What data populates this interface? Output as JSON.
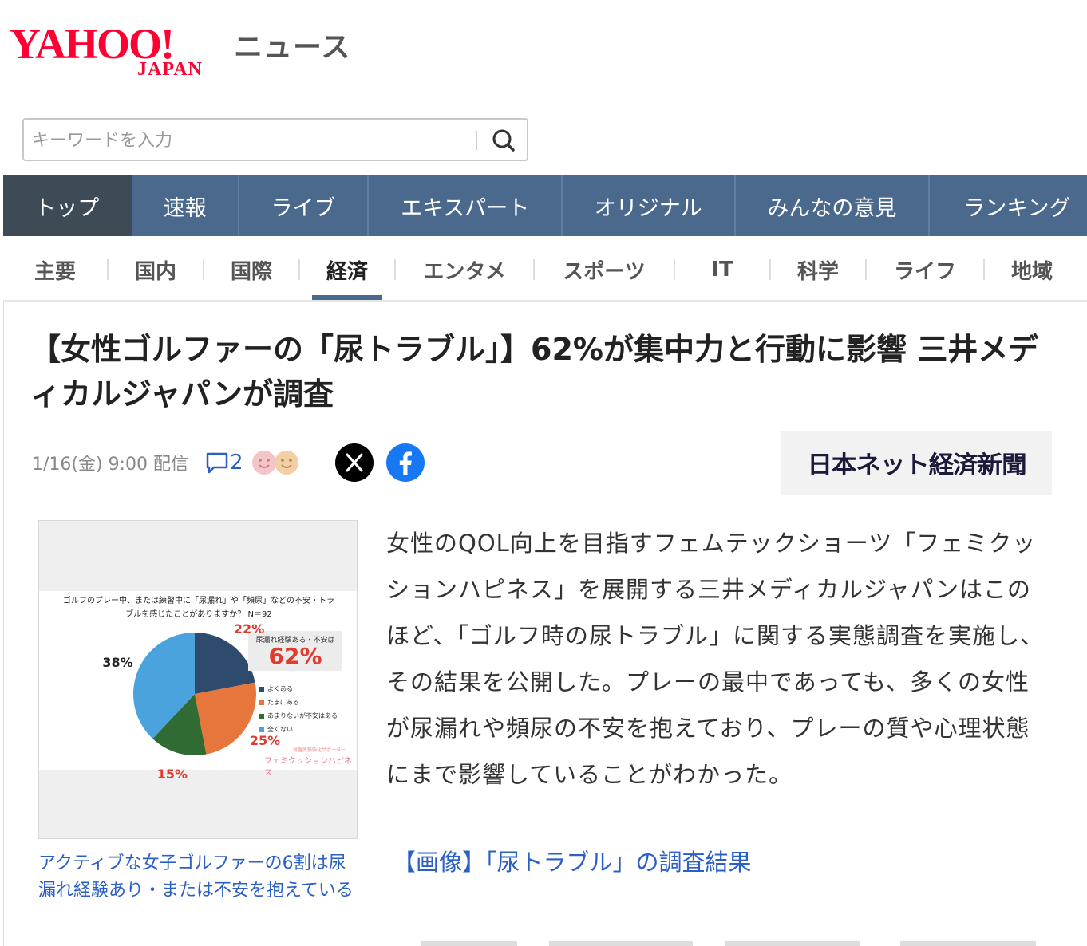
{
  "header": {
    "logo_yahoo": "YAHOO!",
    "logo_japan": "JAPAN",
    "logo_news": "ニュース"
  },
  "search": {
    "placeholder": "キーワードを入力",
    "icon": "search-icon"
  },
  "main_nav": {
    "items": [
      {
        "label": "トップ",
        "active": true
      },
      {
        "label": "速報"
      },
      {
        "label": "ライブ"
      },
      {
        "label": "エキスパート"
      },
      {
        "label": "オリジナル"
      },
      {
        "label": "みんなの意見"
      },
      {
        "label": "ランキング"
      }
    ]
  },
  "sub_nav": {
    "items": [
      {
        "label": "主要"
      },
      {
        "label": "国内"
      },
      {
        "label": "国際"
      },
      {
        "label": "経済",
        "active": true
      },
      {
        "label": "エンタメ"
      },
      {
        "label": "スポーツ"
      },
      {
        "label": "IT"
      },
      {
        "label": "科学"
      },
      {
        "label": "ライフ"
      },
      {
        "label": "地域"
      }
    ]
  },
  "article": {
    "headline": "【女性ゴルファーの「尿トラブル」】62%が集中力と行動に影響 三井メディカルジャパンが調査",
    "date": "1/16(金) 9:00 配信",
    "comment_count": "2",
    "publisher": "日本ネット経済新聞",
    "body": "女性のQOL向上を目指すフェムテックショーツ「フェミクッションハピネス」を展開する三井メディカルジャパンはこのほど、「ゴルフ時の尿トラブル」に関する実態調査を実施し、その結果を公開した。プレーの最中であっても、多くの女性が尿漏れや頻尿の不安を抱えており、プレーの質や心理状態にまで影響していることがわかった。",
    "image_link": "【画像】「尿トラブル」の調査結果",
    "figure_caption": "アクティブな女子ゴルファーの6割は尿漏れ経験あり・または不安を抱えている"
  },
  "figure": {
    "title": "ゴルフのプレー中、または練習中に「尿漏れ」や「頻尿」などの不安・トラブルを感じたことがありますか？ N＝92",
    "callout_label": "尿漏れ経験ある・不安は",
    "callout_value": "62%",
    "sponsor_sub": "骨盤底筋強化サポーター",
    "sponsor_name": "フェミクッションハピネス"
  },
  "colors": {
    "nav_bg": "#4b698c",
    "nav_active": "#3f4a57",
    "link": "#2a5fc5",
    "logo_red": "#ff0033"
  },
  "chart_data": {
    "type": "pie",
    "categories": [
      "よくある",
      "たまにある",
      "あまりないが不安はある",
      "全くない"
    ],
    "values": [
      22,
      25,
      15,
      38
    ],
    "labels": [
      "22%",
      "25%",
      "15%",
      "38%"
    ],
    "colors": [
      "#2e4b6e",
      "#e6763c",
      "#2f6b32",
      "#4aa3dc"
    ],
    "label_colors": [
      "#e03b2e",
      "#e03b2e",
      "#e03b2e",
      "#222222"
    ],
    "legend": "right"
  }
}
